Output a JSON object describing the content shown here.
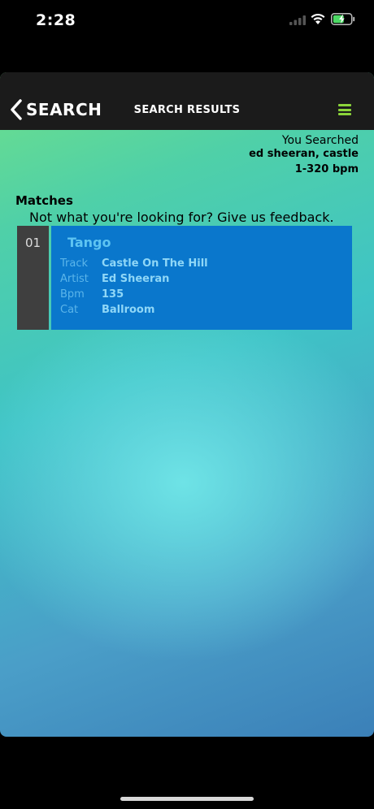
{
  "status_bar": {
    "time": "2:28"
  },
  "nav": {
    "back_label": "SEARCH",
    "title": "SEARCH RESULTS"
  },
  "search_summary": {
    "label": "You Searched",
    "query": "ed sheeran, castle",
    "bpm_range": "1-320 bpm"
  },
  "matches": {
    "title": "Matches",
    "feedback": "Not what you're looking for? Give us feedback."
  },
  "results": [
    {
      "index": "01",
      "dance": "Tango",
      "fields": [
        {
          "label": "Track",
          "value": "Castle On The Hill"
        },
        {
          "label": "Artist",
          "value": "Ed Sheeran"
        },
        {
          "label": "Bpm",
          "value": "135"
        },
        {
          "label": "Cat",
          "value": "Ballroom"
        }
      ]
    }
  ],
  "colors": {
    "nav_bg": "#1b1b1b",
    "menu_accent": "#8bd43a",
    "result_bg": "#0a77cc",
    "index_bg": "#3f3f3f",
    "dance_text": "#5ec4f2"
  },
  "icons": {
    "back": "chevron-left-icon",
    "menu": "hamburger-menu-icon",
    "signal": "signal-icon",
    "wifi": "wifi-icon",
    "battery": "battery-charging-icon"
  }
}
